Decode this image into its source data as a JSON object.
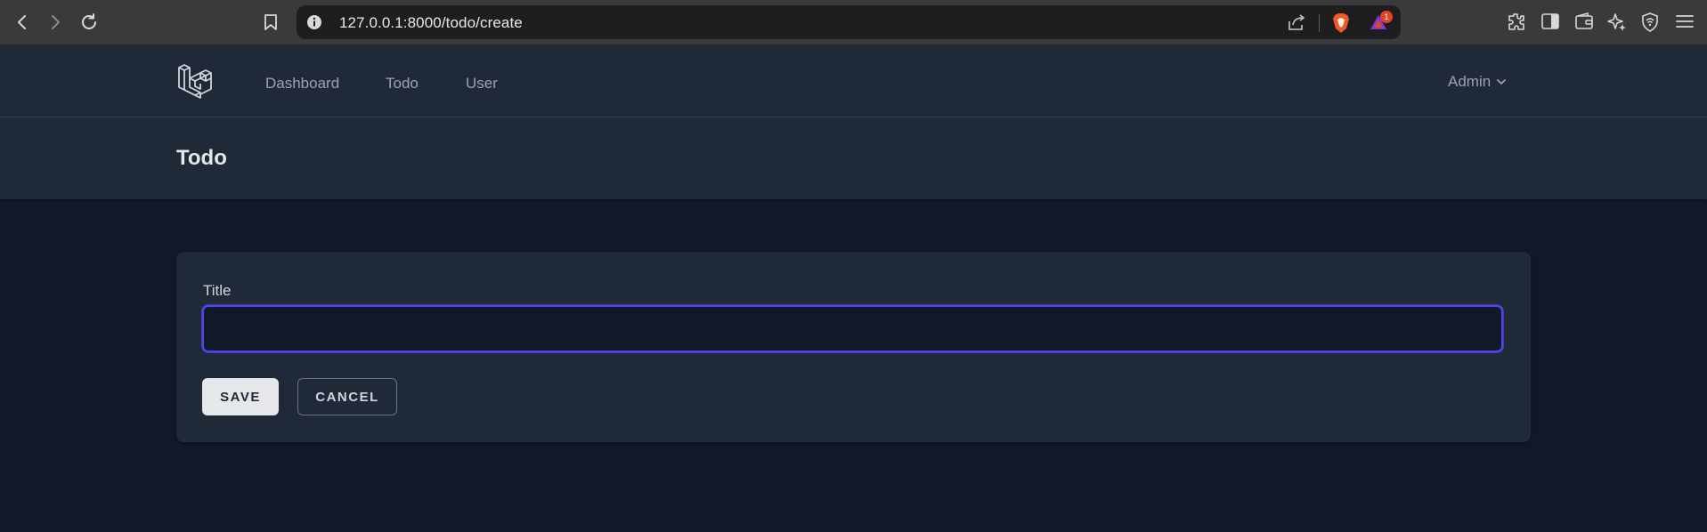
{
  "browser": {
    "url": "127.0.0.1:8000/todo/create",
    "rewards_badge": "1"
  },
  "nav": {
    "links": [
      "Dashboard",
      "Todo",
      "User"
    ],
    "user": "Admin"
  },
  "page": {
    "title": "Todo"
  },
  "form": {
    "title_label": "Title",
    "title_value": "",
    "save_label": "SAVE",
    "cancel_label": "CANCEL"
  },
  "colors": {
    "nav_bg": "#1f2937",
    "page_bg": "#111827",
    "focus_ring": "#4f46e5"
  }
}
